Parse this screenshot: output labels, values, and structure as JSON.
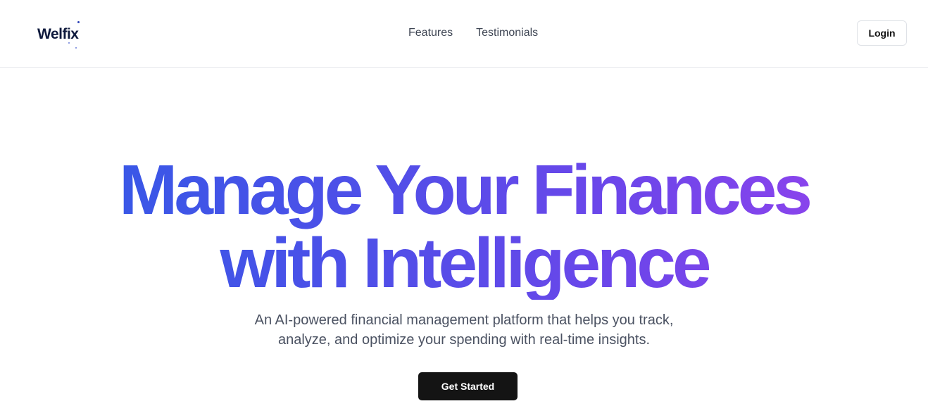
{
  "header": {
    "logo_text": "Welfix",
    "nav": [
      {
        "label": "Features"
      },
      {
        "label": "Testimonials"
      }
    ],
    "login_label": "Login"
  },
  "hero": {
    "title_line1": "Manage Your Finances",
    "title_line2": "with Intelligence",
    "subtitle_line1": "An AI-powered financial management platform that helps you track,",
    "subtitle_line2": "analyze, and optimize your spending with real-time insights.",
    "cta_label": "Get Started"
  },
  "colors": {
    "gradient_start": "#2f5be6",
    "gradient_end": "#9a44ee",
    "cta_background": "#141414",
    "logo": "#0f1a3d"
  }
}
